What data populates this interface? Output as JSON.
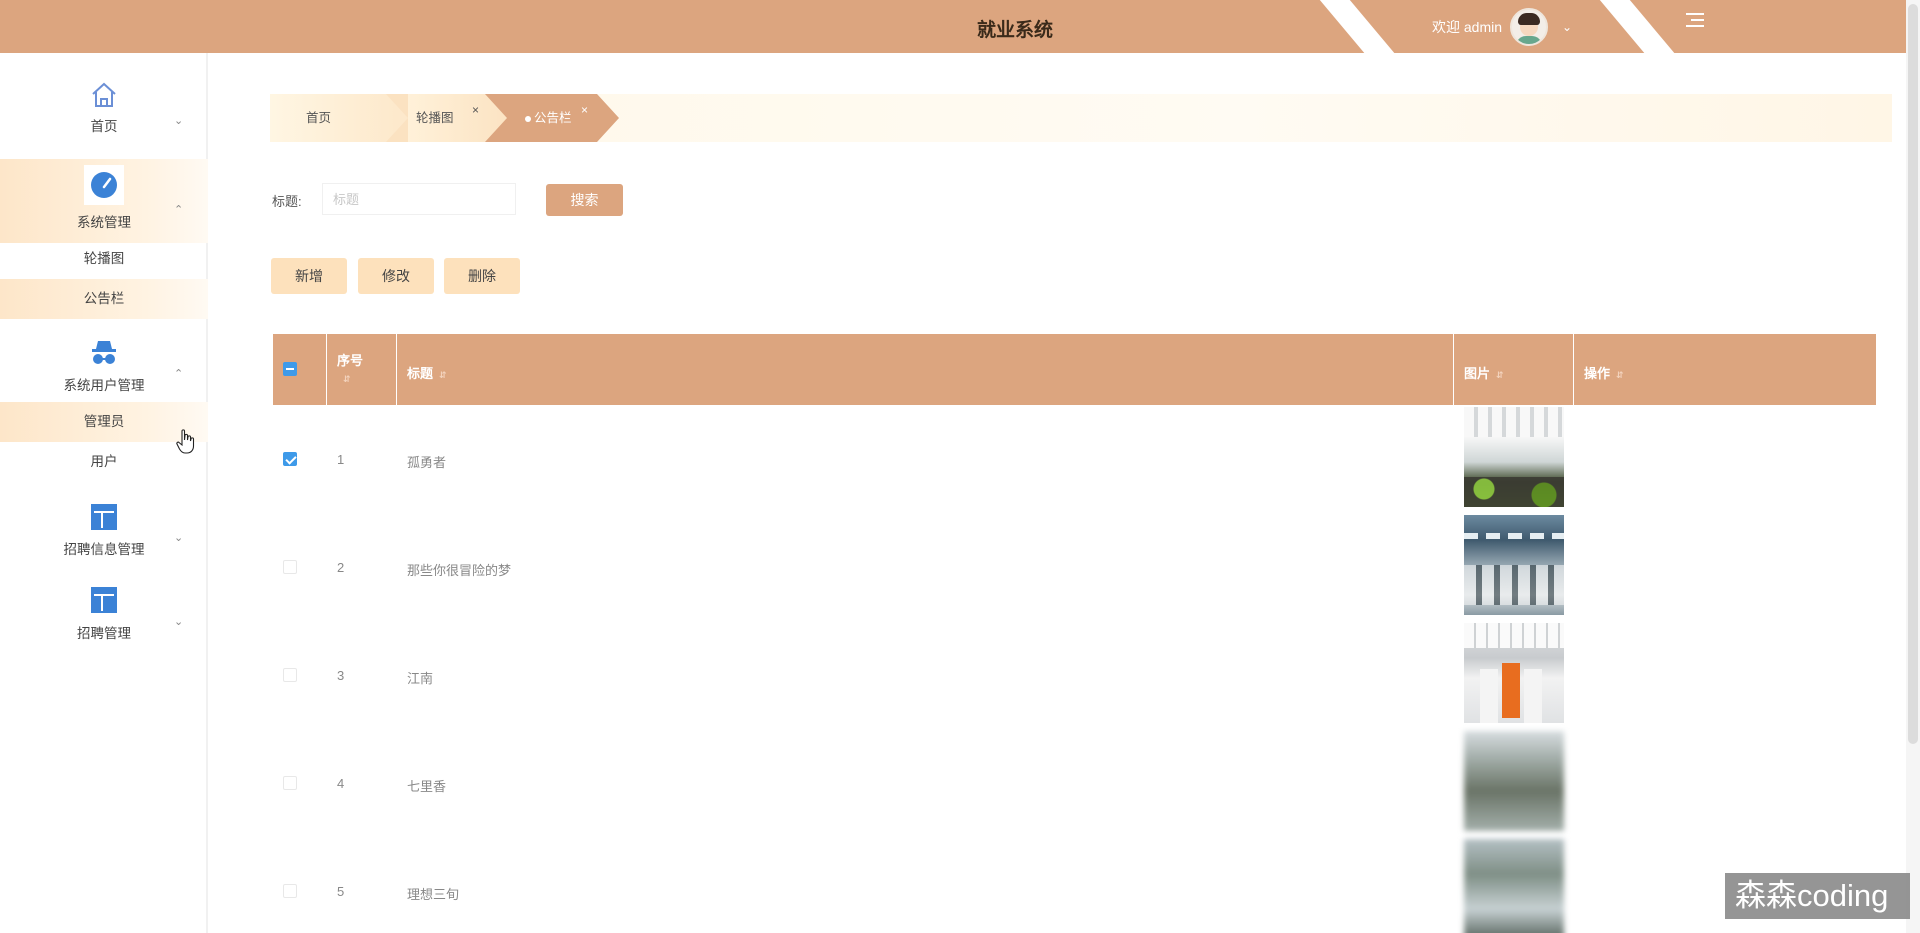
{
  "app": {
    "title": "就业系统"
  },
  "header": {
    "welcome": "欢迎 admin"
  },
  "sidebar": {
    "home": {
      "label": "首页"
    },
    "system": {
      "label": "系统管理",
      "items": [
        {
          "label": "轮播图"
        },
        {
          "label": "公告栏"
        }
      ]
    },
    "users": {
      "label": "系统用户管理",
      "items": [
        {
          "label": "管理员"
        },
        {
          "label": "用户"
        }
      ]
    },
    "recruit_info": {
      "label": "招聘信息管理"
    },
    "recruit": {
      "label": "招聘管理"
    }
  },
  "tabs": [
    {
      "label": "首页"
    },
    {
      "label": "轮播图",
      "close": "×"
    },
    {
      "label": "公告栏",
      "close": "×"
    }
  ],
  "search": {
    "label": "标题:",
    "placeholder": "标题",
    "button": "搜索"
  },
  "actions": {
    "add": "新增",
    "edit": "修改",
    "delete": "删除"
  },
  "table": {
    "columns": {
      "index": "序号",
      "title": "标题",
      "image": "图片",
      "ops": "操作"
    },
    "rows": [
      {
        "index": "1",
        "title": "孤勇者",
        "checked": true
      },
      {
        "index": "2",
        "title": "那些你很冒险的梦",
        "checked": false
      },
      {
        "index": "3",
        "title": "江南",
        "checked": false
      },
      {
        "index": "4",
        "title": "七里香",
        "checked": false
      },
      {
        "index": "5",
        "title": "理想三旬",
        "checked": false
      }
    ]
  },
  "watermark": "森森coding",
  "colors": {
    "primary": "#dca57f",
    "accent_light": "#fde1bc",
    "checkbox": "#3e9ae9"
  }
}
